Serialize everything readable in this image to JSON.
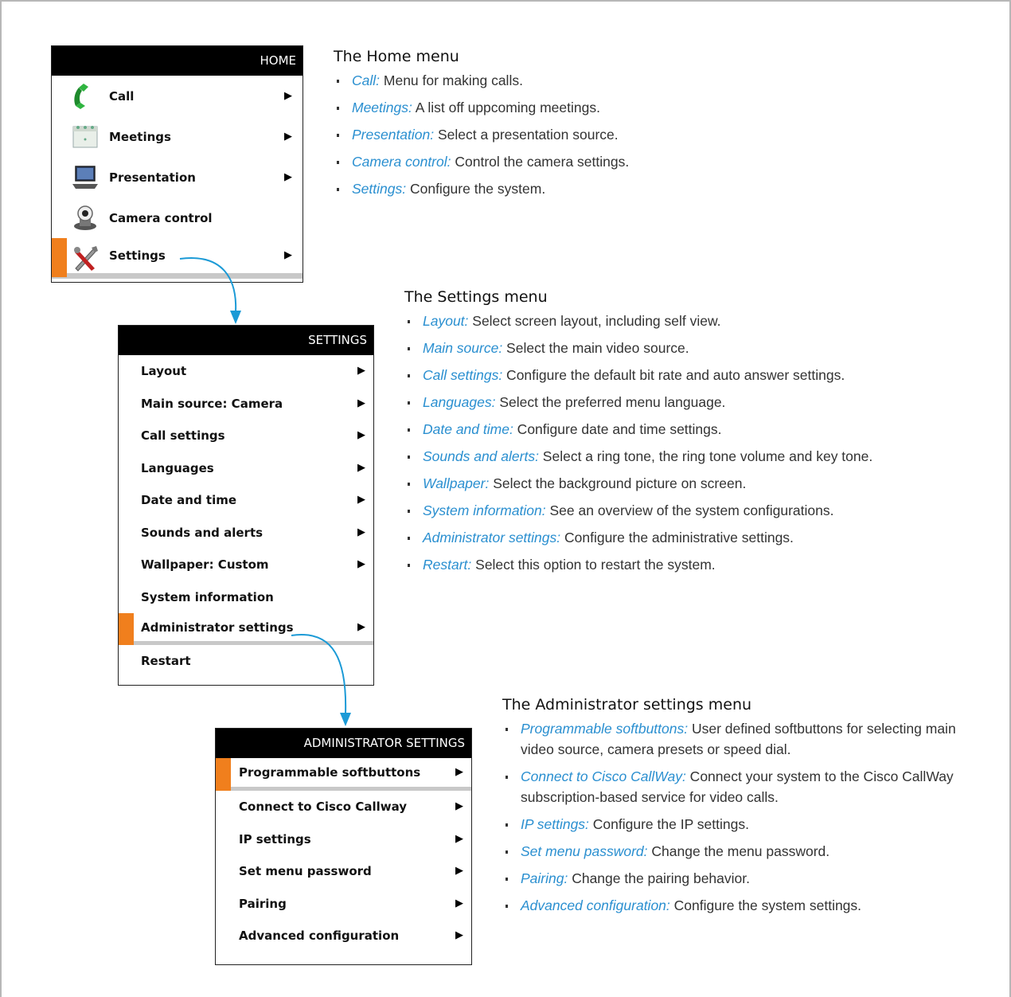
{
  "home_menu": {
    "header": "HOME",
    "items": [
      {
        "label": "Call",
        "icon": "phone-handset-icon",
        "arrow": true
      },
      {
        "label": "Meetings",
        "icon": "calendar-icon",
        "arrow": true
      },
      {
        "label": "Presentation",
        "icon": "laptop-icon",
        "arrow": true
      },
      {
        "label": "Camera control",
        "icon": "camera-icon",
        "arrow": false
      },
      {
        "label": "Settings",
        "icon": "tools-icon",
        "arrow": true,
        "selected": true
      }
    ],
    "arrow_glyph": "▶"
  },
  "settings_menu": {
    "header": "SETTINGS",
    "items": [
      {
        "label": "Layout",
        "arrow": true
      },
      {
        "label": "Main source: Camera",
        "arrow": true
      },
      {
        "label": "Call settings",
        "arrow": true
      },
      {
        "label": "Languages",
        "arrow": true
      },
      {
        "label": "Date and time",
        "arrow": true
      },
      {
        "label": "Sounds and alerts",
        "arrow": true
      },
      {
        "label": "Wallpaper: Custom",
        "arrow": true
      },
      {
        "label": "System information",
        "arrow": false
      },
      {
        "label": "Administrator settings",
        "arrow": true,
        "selected": true
      },
      {
        "label": "Restart",
        "arrow": false
      }
    ]
  },
  "admin_menu": {
    "header": "ADMINISTRATOR SETTINGS",
    "items": [
      {
        "label": "Programmable softbuttons",
        "arrow": true,
        "selected": true
      },
      {
        "label": "Connect to Cisco Callway",
        "arrow": true
      },
      {
        "label": "IP settings",
        "arrow": true
      },
      {
        "label": "Set menu password",
        "arrow": true
      },
      {
        "label": "Pairing",
        "arrow": true
      },
      {
        "label": "Advanced configuration",
        "arrow": true
      }
    ]
  },
  "home_section": {
    "title": "The Home menu",
    "bullets": [
      {
        "term": "Call:",
        "text": " Menu for making calls."
      },
      {
        "term": "Meetings:",
        "text": " A list off uppcoming meetings."
      },
      {
        "term": "Presentation:",
        "text": " Select a presentation source."
      },
      {
        "term": "Camera control:",
        "text": " Control the camera settings."
      },
      {
        "term": "Settings:",
        "text": " Configure the system."
      }
    ]
  },
  "settings_section": {
    "title": "The Settings menu",
    "bullets": [
      {
        "term": "Layout:",
        "text": " Select screen layout, including self view."
      },
      {
        "term": "Main source:",
        "text": " Select the main video source."
      },
      {
        "term": "Call settings:",
        "text": " Configure the default bit rate and auto answer settings."
      },
      {
        "term": "Languages:",
        "text": " Select the preferred menu language."
      },
      {
        "term": "Date and time:",
        "text": " Configure date and time settings."
      },
      {
        "term": "Sounds and alerts:",
        "text": " Select a ring tone, the ring tone volume and key tone."
      },
      {
        "term": "Wallpaper:",
        "text": " Select the background picture on screen."
      },
      {
        "term": "System information:",
        "text": " See an overview of the system configurations."
      },
      {
        "term": "Administrator settings:",
        "text": " Configure the administrative settings."
      },
      {
        "term": "Restart:",
        "text": " Select this option to restart the system."
      }
    ]
  },
  "admin_section": {
    "title": "The Administrator settings menu",
    "bullets": [
      {
        "term": "Programmable softbuttons:",
        "text": " User defined softbuttons for selecting main video source, camera presets or speed dial."
      },
      {
        "term": "Connect to Cisco CallWay:",
        "text": " Connect your system to the Cisco CallWay subscription-based service for video calls."
      },
      {
        "term": "IP settings:",
        "text": " Configure the IP settings."
      },
      {
        "term": "Set menu password:",
        "text": " Change the menu password."
      },
      {
        "term": "Pairing:",
        "text": " Change the pairing behavior."
      },
      {
        "term": "Advanced configuration:",
        "text": " Configure the system settings."
      }
    ]
  },
  "colors": {
    "accent": "#f07f1d",
    "link": "#2a8fd0",
    "connector": "#1b9ad6"
  }
}
